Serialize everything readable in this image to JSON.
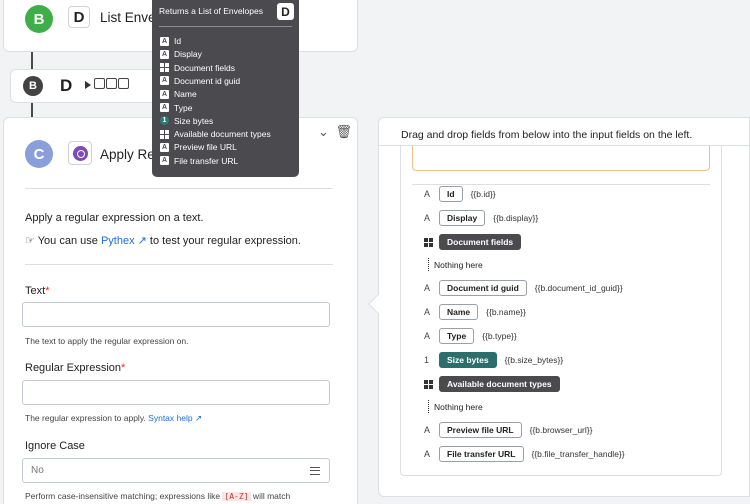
{
  "step_b1": {
    "badge": "B",
    "icon_letter": "D",
    "title": "List Envelo"
  },
  "step_b2": {
    "badge": "B",
    "icon_letter": "D"
  },
  "step_c": {
    "badge": "C",
    "title": "Apply Reg",
    "description": "Apply a regular expression on a text.",
    "tip_prefix": "You can use ",
    "tip_link": "Pythex",
    "tip_suffix": " to test your regular expression.",
    "text_field": {
      "label": "Text",
      "required": "*",
      "help": "The text to apply the regular expression on."
    },
    "regex_field": {
      "label": "Regular Expression",
      "required": "*",
      "help": "The regular expression to apply. ",
      "help_link": "Syntax help"
    },
    "ignore_case": {
      "label": "Ignore Case",
      "value": "No",
      "help_prefix": "Perform case-insensitive matching; expressions like ",
      "help_code": "[A-Z]",
      "help_suffix": " will match"
    }
  },
  "tooltip": {
    "title": "Returns a List of Envelopes",
    "badge": "D",
    "items": [
      {
        "type": "A",
        "label": "Id"
      },
      {
        "type": "A",
        "label": "Display"
      },
      {
        "type": "grid",
        "label": "Document fields"
      },
      {
        "type": "A",
        "label": "Document id guid"
      },
      {
        "type": "A",
        "label": "Name"
      },
      {
        "type": "A",
        "label": "Type"
      },
      {
        "type": "1",
        "label": "Size bytes"
      },
      {
        "type": "grid",
        "label": "Available document types"
      },
      {
        "type": "A",
        "label": "Preview file URL"
      },
      {
        "type": "A",
        "label": "File transfer URL"
      }
    ]
  },
  "panel": {
    "header": "Drag and drop fields from below into the input fields on the left.",
    "fields": [
      {
        "type": "A",
        "chip": "Id",
        "path": "{{b.id}}",
        "style": "light"
      },
      {
        "type": "A",
        "chip": "Display",
        "path": "{{b.display}}",
        "style": "light"
      },
      {
        "type": "grid",
        "chip": "Document fields",
        "path": "",
        "style": "dark"
      },
      {
        "type": "nothing",
        "chip": "Nothing here",
        "path": "",
        "style": "none"
      },
      {
        "type": "A",
        "chip": "Document id guid",
        "path": "{{b.document_id_guid}}",
        "style": "light"
      },
      {
        "type": "A",
        "chip": "Name",
        "path": "{{b.name}}",
        "style": "light"
      },
      {
        "type": "A",
        "chip": "Type",
        "path": "{{b.type}}",
        "style": "light"
      },
      {
        "type": "1",
        "chip": "Size bytes",
        "path": "{{b.size_bytes}}",
        "style": "teal"
      },
      {
        "type": "grid",
        "chip": "Available document types",
        "path": "",
        "style": "dark"
      },
      {
        "type": "nothing",
        "chip": "Nothing here",
        "path": "",
        "style": "none"
      },
      {
        "type": "A",
        "chip": "Preview file URL",
        "path": "{{b.browser_url}}",
        "style": "light"
      },
      {
        "type": "A",
        "chip": "File transfer URL",
        "path": "{{b.file_transfer_handle}}",
        "style": "light"
      }
    ]
  }
}
